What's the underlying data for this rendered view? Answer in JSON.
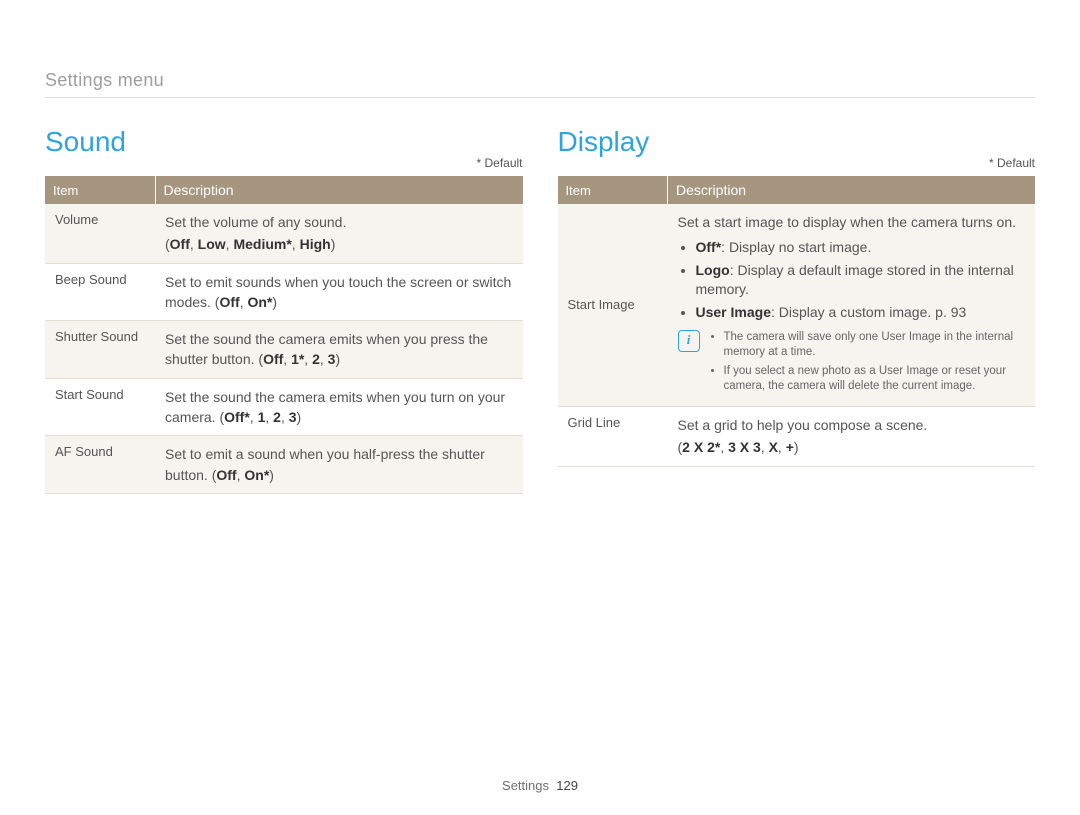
{
  "breadcrumb": "Settings menu",
  "footer": {
    "section": "Settings",
    "page": "129"
  },
  "default_marker": "* Default",
  "headers": {
    "item": "Item",
    "description": "Description"
  },
  "sound": {
    "title": "Sound",
    "rows": [
      {
        "item": "Volume",
        "desc": "Set the volume of any sound.",
        "opts_open": "(",
        "o1": "Off",
        "s1": ", ",
        "o2": "Low",
        "s2": ", ",
        "o3": "Medium*",
        "s3": ", ",
        "o4": "High",
        "opts_close": ")"
      },
      {
        "item": "Beep Sound",
        "desc": "Set to emit sounds when you touch the screen or switch modes. (",
        "o1": "Off",
        "s1": ", ",
        "o2": "On*",
        "tail": ")"
      },
      {
        "item": "Shutter Sound",
        "desc": "Set the sound the camera emits when you press the shutter button. (",
        "o1": "Off",
        "s1": ", ",
        "o2": "1*",
        "s2": ", ",
        "o3": "2",
        "s3": ", ",
        "o4": "3",
        "tail": ")"
      },
      {
        "item": "Start Sound",
        "desc": "Set the sound the camera emits when you turn on your camera. (",
        "o1": "Off*",
        "s1": ", ",
        "o2": "1",
        "s2": ", ",
        "o3": "2",
        "s3": ", ",
        "o4": "3",
        "tail": ")"
      },
      {
        "item": "AF Sound",
        "desc": "Set to emit a sound when you half-press the shutter button. (",
        "o1": "Off",
        "s1": ", ",
        "o2": "On*",
        "tail": ")"
      }
    ]
  },
  "display": {
    "title": "Display",
    "start_image": {
      "item": "Start Image",
      "intro": "Set a start image to display when the camera turns on.",
      "b1_label": "Off*",
      "b1_text": ": Display no start image.",
      "b2_label": "Logo",
      "b2_text": ": Display a default image stored in the internal memory.",
      "b3_label": "User Image",
      "b3_text": ": Display a custom image. p. 93",
      "note1": "The camera will save only one User Image in the internal memory at a time.",
      "note2": "If you select a new photo as a User Image or reset your camera, the camera will delete the current image."
    },
    "grid_line": {
      "item": "Grid Line",
      "desc": "Set a grid to help you compose a scene.",
      "opts_open": "(",
      "o1": "2 X 2*",
      "s1": ", ",
      "o2": "3 X 3",
      "s2": ", ",
      "o3": "X",
      "s3": ", ",
      "o4": "+",
      "opts_close": ")"
    }
  }
}
